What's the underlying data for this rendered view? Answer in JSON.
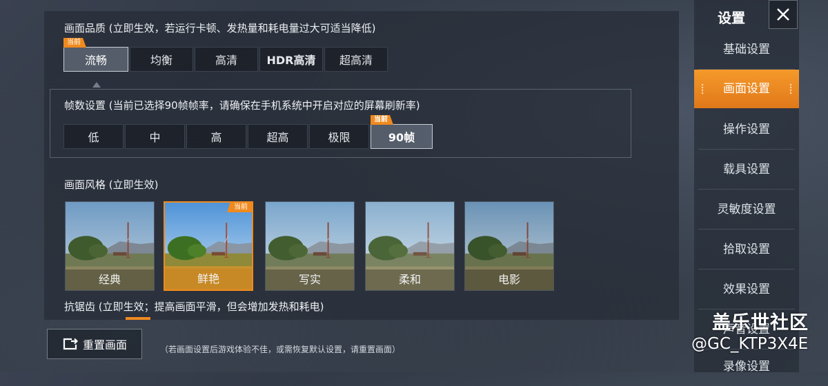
{
  "quality": {
    "title": "画面品质 (立即生效，若运行卡顿、发热量和耗电量过大可适当降低)",
    "current_tag": "当前",
    "options": [
      "流畅",
      "均衡",
      "高清",
      "HDR高清",
      "超高清"
    ],
    "selected": "流畅"
  },
  "fps": {
    "title": "帧数设置 (当前已选择90帧帧率，请确保在手机系统中开启对应的屏幕刷新率)",
    "current_tag": "当前",
    "options": [
      "低",
      "中",
      "高",
      "超高",
      "极限",
      "90帧"
    ],
    "selected": "90帧"
  },
  "style": {
    "title": "画面风格 (立即生效)",
    "current_tag": "当前",
    "options": [
      "经典",
      "鲜艳",
      "写实",
      "柔和",
      "电影"
    ],
    "selected": "鲜艳"
  },
  "antialias": {
    "title": "抗锯齿 (立即生效；提高画面平滑，但会增加发热和耗电)"
  },
  "footer": {
    "reset_label": "重置画面",
    "hint": "（若画面设置后游戏体验不佳，或需恢复默认设置，请重置画面）"
  },
  "sidebar": {
    "title": "设置",
    "items": [
      "基础设置",
      "画面设置",
      "操作设置",
      "载具设置",
      "灵敏度设置",
      "拾取设置",
      "效果设置",
      "声音设置",
      "录像设置"
    ],
    "selected": "画面设置"
  },
  "watermark": {
    "line1": "盖乐世社区",
    "line2": "@GC_KTP3X4E"
  },
  "colors": {
    "accent": "#f08a1e",
    "panel": "#282e38"
  }
}
